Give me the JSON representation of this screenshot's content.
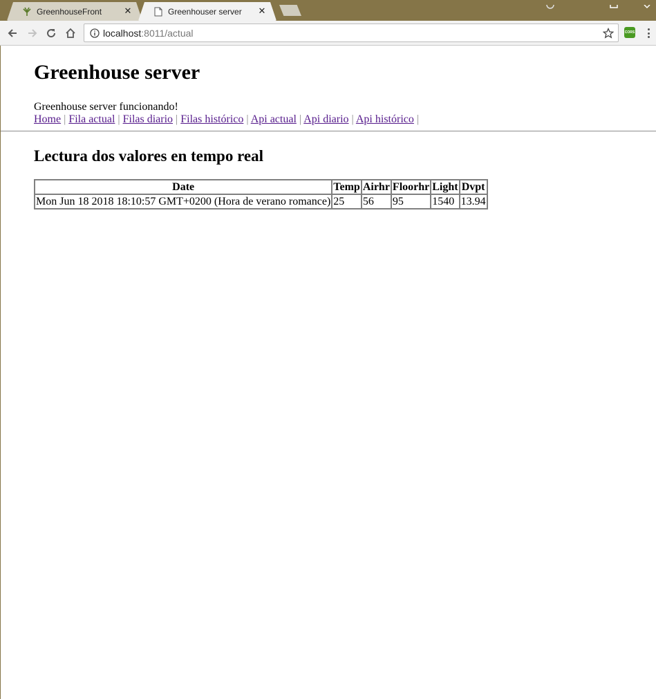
{
  "browser": {
    "tabs": [
      {
        "title": "GreenhouseFront",
        "active": false,
        "icon": "plant-icon"
      },
      {
        "title": "Greenhouser server",
        "active": true,
        "icon": "document-icon"
      }
    ],
    "close_glyph": "✕",
    "address": {
      "host": "localhost",
      "path": ":8011/actual"
    },
    "extension_label": "CORS"
  },
  "page": {
    "title": "Greenhouse server",
    "status": "Greenhouse server funcionando!",
    "nav_links": [
      {
        "label": "Home"
      },
      {
        "label": "Fila actual"
      },
      {
        "label": "Filas diario"
      },
      {
        "label": "Filas histórico"
      },
      {
        "label": "Api actual"
      },
      {
        "label": "Api diario"
      },
      {
        "label": "Api histórico"
      }
    ],
    "separator": "|",
    "section_title": "Lectura dos valores en tempo real",
    "table": {
      "headers": [
        "Date",
        "Temp",
        "Airhr",
        "Floorhr",
        "Light",
        "Dvpt"
      ],
      "rows": [
        [
          "Mon Jun 18 2018 18:10:57 GMT+0200 (Hora de verano romance)",
          "25",
          "56",
          "95",
          "1540",
          "13.94"
        ]
      ]
    }
  },
  "colors": {
    "frame": "#857548",
    "visited_link": "#551a8b"
  }
}
